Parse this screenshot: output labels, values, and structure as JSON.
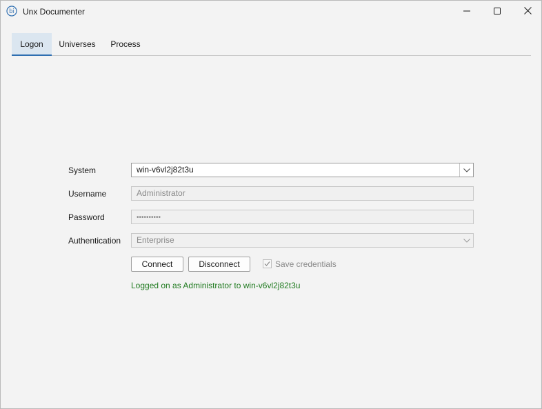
{
  "window": {
    "title": "Unx Documenter",
    "app_icon": "bi-logo-icon",
    "controls": [
      "minimize-icon",
      "maximize-icon",
      "close-icon"
    ]
  },
  "tabs": [
    {
      "label": "Logon",
      "selected": true
    },
    {
      "label": "Universes",
      "selected": false
    },
    {
      "label": "Process",
      "selected": false
    }
  ],
  "logon": {
    "system_label": "System",
    "system_value": "win-v6vl2j82t3u",
    "username_label": "Username",
    "username_value": "Administrator",
    "password_label": "Password",
    "password_value": "••••••••••",
    "authentication_label": "Authentication",
    "authentication_value": "Enterprise",
    "connect_label": "Connect",
    "disconnect_label": "Disconnect",
    "save_credentials_label": "Save credentials",
    "save_credentials_checked": true,
    "status_text": "Logged on as Administrator to win-v6vl2j82t3u"
  },
  "colors": {
    "accent": "#2f6fb1",
    "tab_selected_bg": "#dbe6f0",
    "status_text": "#1f7a1f",
    "window_bg": "#f3f3f3"
  }
}
